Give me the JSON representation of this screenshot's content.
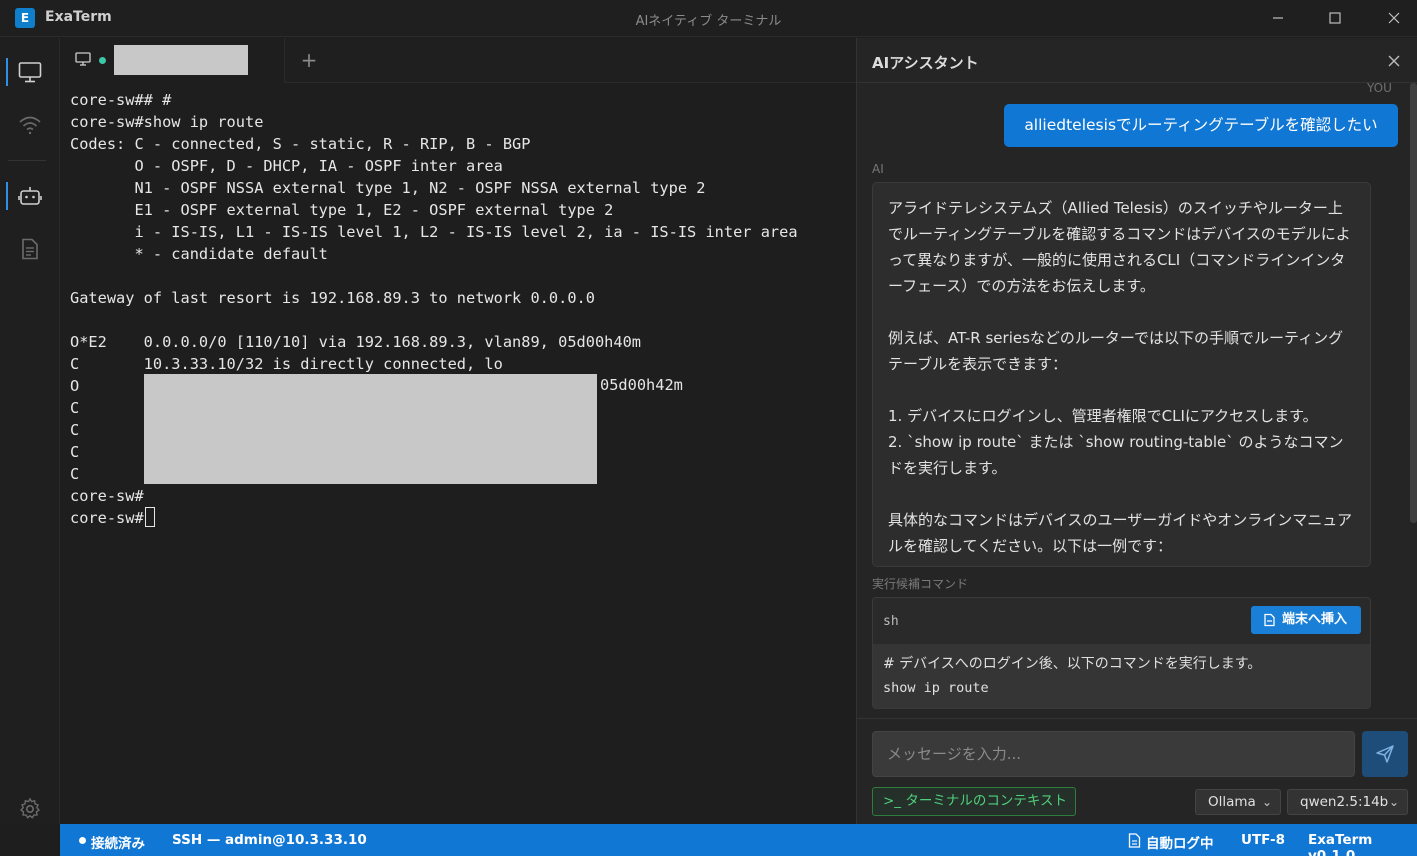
{
  "app": {
    "logo_letter": "E",
    "name": "ExaTerm",
    "window_title": "AIネイティブ ターミナル"
  },
  "activity_bar": {
    "items": [
      "monitor-icon",
      "wifi-icon",
      "robot-icon",
      "document-icon"
    ],
    "bottom": "gear-icon"
  },
  "tabs": {
    "active_tab_status": "connected",
    "add_label": "+"
  },
  "terminal": {
    "lines": [
      "core-sw## #",
      "core-sw#show ip route",
      "Codes: C - connected, S - static, R - RIP, B - BGP",
      "       O - OSPF, D - DHCP, IA - OSPF inter area",
      "       N1 - OSPF NSSA external type 1, N2 - OSPF NSSA external type 2",
      "       E1 - OSPF external type 1, E2 - OSPF external type 2",
      "       i - IS-IS, L1 - IS-IS level 1, L2 - IS-IS level 2, ia - IS-IS inter area",
      "       * - candidate default",
      "",
      "Gateway of last resort is 192.168.89.3 to network 0.0.0.0",
      "",
      "O*E2    0.0.0.0/0 [110/10] via 192.168.89.3, vlan89, 05d00h40m",
      "C       10.3.33.10/32 is directly connected, lo",
      "O",
      "C",
      "C",
      "C",
      "C",
      "core-sw#"
    ],
    "prompt": "core-sw#",
    "route_uptime": "05d00h42m"
  },
  "ai_panel": {
    "title": "AIアシスタント",
    "you_label": "YOU",
    "user_message": "alliedtelesisでルーティングテーブルを確認したい",
    "ai_label": "AI",
    "ai_paragraphs": [
      "アライドテレシステムズ（Allied Telesis）のスイッチやルーター上でルーティングテーブルを確認するコマンドはデバイスのモデルによって異なりますが、一般的に使用されるCLI（コマンドラインインターフェース）での方法をお伝えします。",
      "例えば、AT-R seriesなどのルーターでは以下の手順でルーティングテーブルを表示できます：",
      "1. デバイスにログインし、管理者権限でCLIにアクセスします。\n2. `show ip route` または `show routing-table` のようなコマンドを実行します。",
      "具体的なコマンドはデバイスのユーザーガイドやオンラインマニュアルを確認してください。以下は一例です："
    ],
    "command_section_label": "実行候補コマンド",
    "command_lang": "sh",
    "insert_button": "端末へ挿入",
    "command_comment": "# デバイスへのログイン後、以下のコマンドを実行します。",
    "command_text": "show ip route",
    "input_placeholder": "メッセージを入力...",
    "context_button": "ターミナルのコンテキスト",
    "provider": "Ollama",
    "model": "qwen2.5:14b"
  },
  "status_bar": {
    "connection": "接続済み",
    "session": "SSH — admin@10.3.33.10",
    "logging": "自動ログ中",
    "encoding": "UTF-8",
    "version": "ExaTerm v0.1.0"
  },
  "colors": {
    "accent": "#1177d4",
    "connected_dot": "#3ec7a6",
    "context_green": "#4fd07a"
  }
}
